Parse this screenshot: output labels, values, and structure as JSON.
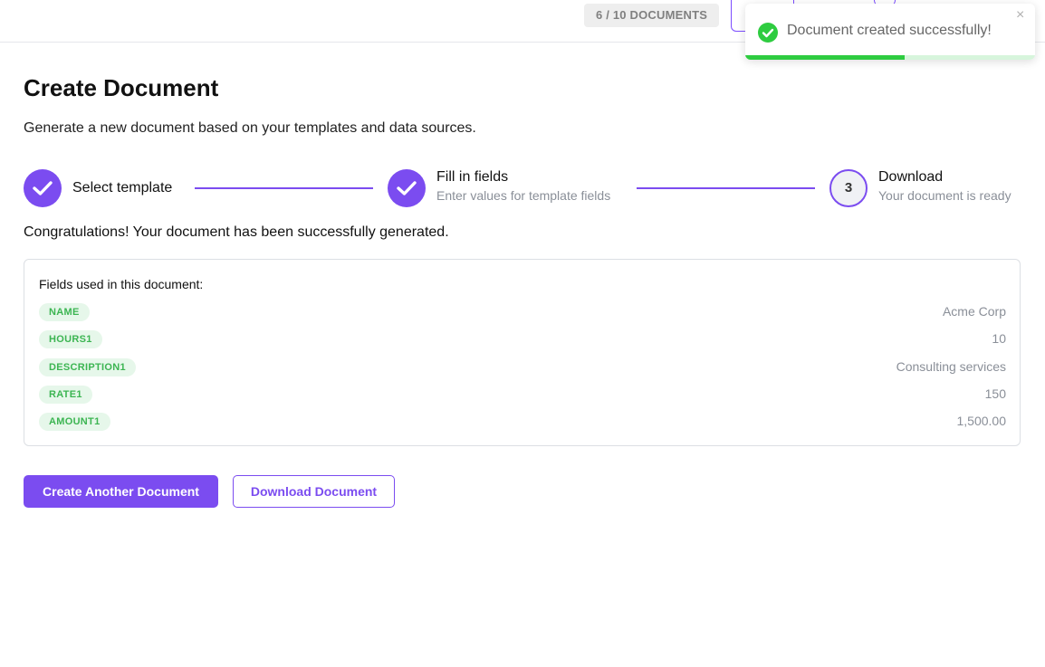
{
  "header": {
    "doc_count": "6 / 10 DOCUMENTS"
  },
  "toast": {
    "message": "Document created successfully!",
    "close_icon": "×",
    "progress": 0.55,
    "accent": "#2ecc40"
  },
  "page": {
    "title": "Create Document",
    "subtitle": "Generate a new document based on your templates and data sources."
  },
  "stepper": {
    "steps": [
      {
        "title": "Select template",
        "description": "",
        "status": "completed",
        "icon": "checkmark-icon"
      },
      {
        "title": "Fill in fields",
        "description": "Enter values for template fields",
        "status": "completed",
        "icon": "checkmark-icon"
      },
      {
        "title": "Download",
        "description": "Your document is ready",
        "status": "current",
        "number": "3"
      }
    ]
  },
  "result": {
    "congrats": "Congratulations! Your document has been successfully generated.",
    "fields_heading": "Fields used in this document:",
    "fields": [
      {
        "key": "NAME",
        "value": "Acme Corp"
      },
      {
        "key": "HOURS1",
        "value": "10"
      },
      {
        "key": "DESCRIPTION1",
        "value": "Consulting services"
      },
      {
        "key": "RATE1",
        "value": "150"
      },
      {
        "key": "AMOUNT1",
        "value": "1,500.00"
      }
    ]
  },
  "actions": {
    "create_another": "Create Another Document",
    "download": "Download Document"
  },
  "colors": {
    "accent": "#7b4cf0",
    "success": "#2ecc40",
    "tag_bg": "#e6f7ea",
    "tag_text": "#3cb552"
  }
}
